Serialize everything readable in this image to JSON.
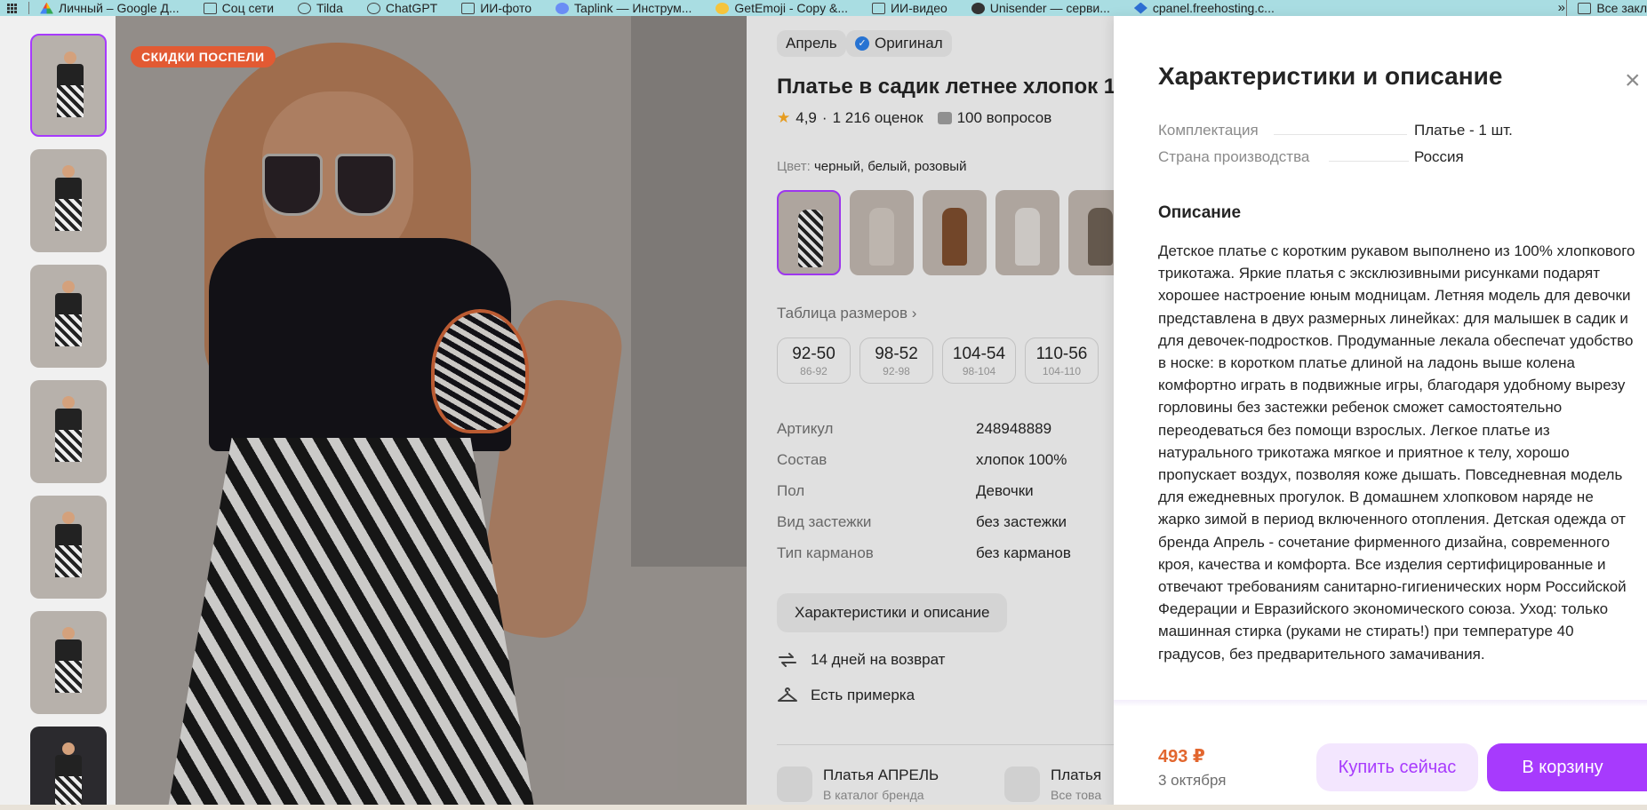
{
  "bookmarks": {
    "items": [
      {
        "label": "Личный – Google Д...",
        "icon": "google-drive-icon"
      },
      {
        "label": "Соц сети",
        "icon": "folder-icon"
      },
      {
        "label": "Tilda",
        "icon": "tilda-icon"
      },
      {
        "label": "ChatGPT",
        "icon": "chatgpt-icon"
      },
      {
        "label": "ИИ-фото",
        "icon": "folder-icon"
      },
      {
        "label": "Taplink — Инструм...",
        "icon": "taplink-icon"
      },
      {
        "label": "GetEmoji - Copy &...",
        "icon": "emoji-icon"
      },
      {
        "label": "ИИ-видео",
        "icon": "folder-icon"
      },
      {
        "label": "Unisender — серви...",
        "icon": "unisender-icon"
      },
      {
        "label": "cpanel.freehosting.c...",
        "icon": "cpanel-icon"
      }
    ],
    "more": "»",
    "all_bookmarks": "Все закл"
  },
  "gallery": {
    "sale_badge": "СКИДКИ ПОСПЕЛИ",
    "thumb_count": 7,
    "active_thumb": 0
  },
  "product": {
    "brand_chip": "Апрель",
    "original_chip": "Оригинал",
    "title": "Платье в садик летнее хлопок 1",
    "rating": "4,9",
    "rating_sep": "·",
    "reviews": "1 216 оценок",
    "questions": "100 вопросов",
    "color_label": "Цвет:",
    "color_value": "черный, белый, розовый",
    "size_table_link": "Таблица размеров ›",
    "sizes": [
      {
        "ru": "92-50",
        "eu": "86-92"
      },
      {
        "ru": "98-52",
        "eu": "92-98"
      },
      {
        "ru": "104-54",
        "eu": "98-104"
      },
      {
        "ru": "110-56",
        "eu": "104-110"
      }
    ],
    "specs": [
      {
        "key": "Артикул",
        "value": "248948889"
      },
      {
        "key": "Состав",
        "value": "хлопок 100%"
      },
      {
        "key": "Пол",
        "value": "Девочки"
      },
      {
        "key": "Вид застежки",
        "value": "без застежки"
      },
      {
        "key": "Тип карманов",
        "value": "без карманов"
      }
    ],
    "characteristics_button": "Характеристики и описание",
    "return_text": "14 дней на возврат",
    "fitting_text": "Есть примерка",
    "brand_card": {
      "title": "Платья АПРЕЛЬ",
      "subtitle": "В каталог бренда"
    },
    "category_card": {
      "title": "Платья",
      "subtitle": "Все това"
    }
  },
  "drawer": {
    "title": "Характеристики и описание",
    "close": "×",
    "rows": [
      {
        "key": "Комплектация",
        "value": "Платье - 1 шт."
      },
      {
        "key": "Страна производства",
        "value": "Россия"
      }
    ],
    "description_heading": "Описание",
    "description": "Детское платье с коротким рукавом выполнено из 100% хлопкового трикотажа. Яркие платья с эксклюзивными рисунками подарят хорошее настроение юным модницам. Летняя модель для девочки представлена в двух размерных линейках: для малышек в садик и для девочек-подростков. Продуманные лекала обеспечат удобство в носке: в коротком платье длиной на ладонь выше колена комфортно играть в подвижные игры, благодаря удобному вырезу горловины без застежки ребенок сможет самостоятельно переодеваться без помощи взрослых. Легкое платье из натурального трикотажа мягкое и приятное к телу, хорошо пропускает воздух, позволяя коже дышать. Повседневная модель для ежедневных прогулок. В домашнем хлопковом наряде не жарко зимой в период включенного отопления. Детская одежда от бренда Апрель - сочетание фирменного дизайна, современного кроя, качества и комфорта. Все изделия сертифицированные и отвечают требованиям санитарно-гигиенических норм Российской Федерации и Евразийского экономического союза. Уход: только машинная стирка (руками не стирать!) при температуре 40 градусов, без предварительного замачивания.",
    "price": "493 ₽",
    "delivery_date": "3 октября",
    "buy_now": "Купить сейчас",
    "add_to_cart": "В корзину"
  },
  "colors": {
    "accent": "#a73afd",
    "price": "#e2662e",
    "sale_badge": "#e25a33",
    "bookmarks_bar": "#a9dde2"
  }
}
